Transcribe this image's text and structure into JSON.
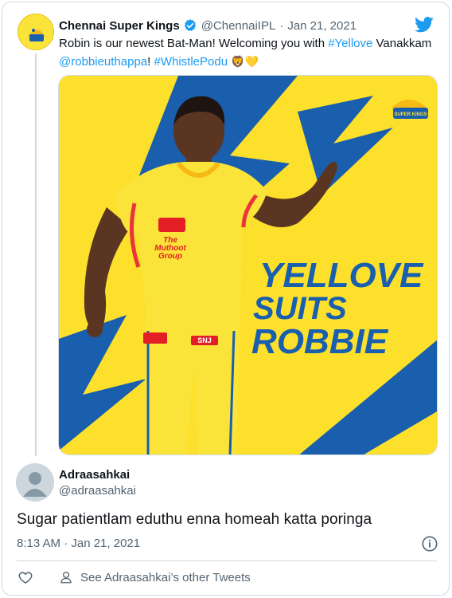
{
  "parent": {
    "name": "Chennai Super Kings",
    "handle": "@ChennaiIPL",
    "separator": "·",
    "date": "Jan 21, 2021",
    "text_1": "Robin is our newest Bat-Man! Welcoming you with ",
    "hashtag_1": "#Yellove",
    "text_2": " Vanakkam",
    "mention": "@robbieuthappa",
    "text_3": "! ",
    "hashtag_2": "#WhistlePodu",
    "emojis": "🦁💛"
  },
  "media": {
    "headline": [
      "YELLOVE",
      "SUITS",
      "ROBBIE"
    ],
    "sponsor_1": "The",
    "sponsor_2": "Muthoot",
    "sponsor_3": "Group",
    "badge": "SNJ",
    "logo_text": "SUPER KINGS"
  },
  "reply": {
    "name": "Adraasahkai",
    "handle": "@adraasahkai",
    "text": "Sugar patientlam eduthu enna homeah katta poringa",
    "timestamp": "8:13 AM · Jan 21, 2021",
    "see_more": "See Adraasahkai’s other Tweets"
  },
  "colors": {
    "link": "#1d9bf0",
    "media_yellow": "#fde02c",
    "media_blue": "#1a5fae",
    "muted": "#536471"
  }
}
